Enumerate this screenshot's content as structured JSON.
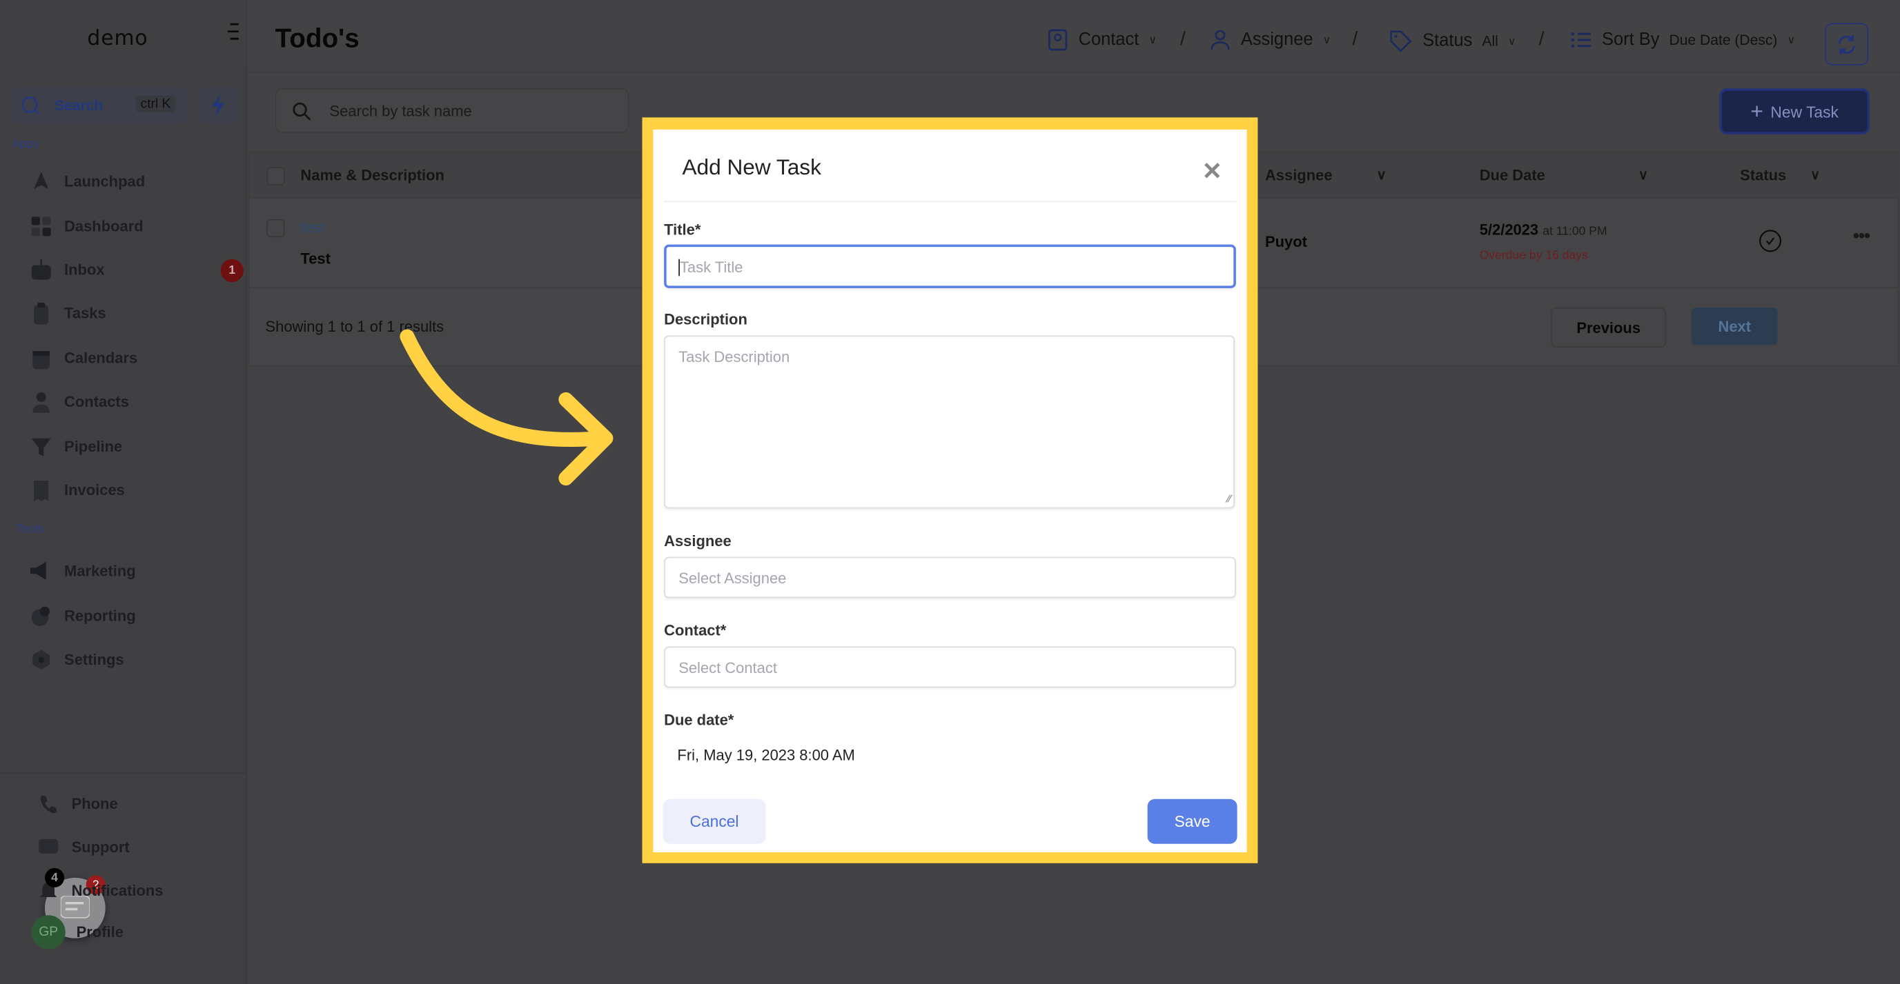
{
  "colors": {
    "accent": "#5A7FE6",
    "highlight": "#FFD143",
    "danger": "#B91C1C",
    "brand_button": "#1F3A9A"
  },
  "sidebar": {
    "logo": "demo",
    "search_label": "Search",
    "search_shortcut": "ctrl K",
    "apps_label": "Apps",
    "tools_label": "Tools",
    "apps": [
      {
        "label": "Launchpad",
        "icon": "rocket-icon"
      },
      {
        "label": "Dashboard",
        "icon": "grid-icon"
      },
      {
        "label": "Inbox",
        "icon": "inbox-icon",
        "badge": "1"
      },
      {
        "label": "Tasks",
        "icon": "clipboard-icon"
      },
      {
        "label": "Calendars",
        "icon": "calendar-icon"
      },
      {
        "label": "Contacts",
        "icon": "person-icon"
      },
      {
        "label": "Pipeline",
        "icon": "filter-icon"
      },
      {
        "label": "Invoices",
        "icon": "receipt-icon"
      }
    ],
    "tools": [
      {
        "label": "Marketing",
        "icon": "megaphone-icon"
      },
      {
        "label": "Reporting",
        "icon": "pie-chart-icon"
      },
      {
        "label": "Settings",
        "icon": "gear-icon"
      }
    ],
    "bottom": [
      {
        "label": "Phone",
        "icon": "phone-icon"
      },
      {
        "label": "Support",
        "icon": "chat-icon"
      },
      {
        "label": "Notifications",
        "icon": "bell-icon",
        "badge": "4"
      },
      {
        "label": "Profile",
        "icon": "avatar",
        "avatar_initials": "GP"
      }
    ],
    "chat_widget_badge": "2"
  },
  "header": {
    "title": "Todo's",
    "filters": {
      "contact": "Contact",
      "assignee": "Assignee",
      "status_label": "Status",
      "status_value": "All",
      "sort_label": "Sort By",
      "sort_value": "Due Date (Desc)"
    }
  },
  "toolbar": {
    "search_placeholder": "Search by task name",
    "new_task": "New Task"
  },
  "table": {
    "columns": [
      "Name & Description",
      "Assignee",
      "Due Date",
      "Status"
    ],
    "rows": [
      {
        "name": "test",
        "description": "Test",
        "assignee": "Puyot",
        "due_date": "5/2/2023",
        "due_time": "at 11:00 PM",
        "overdue": "Overdue by 16 days"
      }
    ],
    "summary": "Showing 1 to 1 of 1 results",
    "previous": "Previous",
    "next": "Next"
  },
  "modal": {
    "title": "Add New Task",
    "title_label": "Title*",
    "title_placeholder": "Task Title",
    "description_label": "Description",
    "description_placeholder": "Task Description",
    "assignee_label": "Assignee",
    "assignee_placeholder": "Select Assignee",
    "contact_label": "Contact*",
    "contact_placeholder": "Select Contact",
    "due_label": "Due date*",
    "due_value": "Fri, May 19, 2023 8:00 AM",
    "cancel": "Cancel",
    "save": "Save"
  }
}
